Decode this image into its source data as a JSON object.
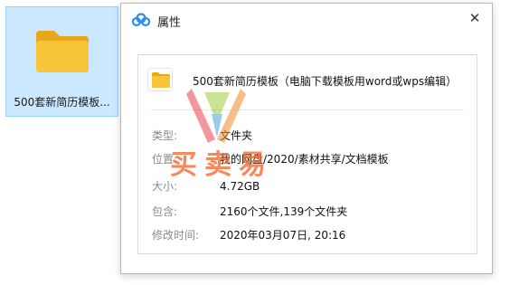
{
  "desktop": {
    "folder_name": "500套新简历模板...",
    "folder_icon": "folder-icon"
  },
  "dialog": {
    "title": "属性",
    "app_icon": "cloud-drive-icon",
    "close_glyph": "✕",
    "header_name": "500套新简历模板（电脑下载模板用word或wps编辑）",
    "fields": {
      "type_label": "类型:",
      "type_value": "文件夹",
      "location_label": "位置:",
      "location_value": "我的网盘/2020/素材共享/文档模板",
      "size_label": "大小:",
      "size_value": "4.72GB",
      "contains_label": "包含:",
      "contains_value": "2160个文件,139个文件夹",
      "modified_label": "修改时间:",
      "modified_value": "2020年03月07日, 20:16"
    }
  },
  "watermark": {
    "text": "买卖易",
    "colors": [
      "#e8434f",
      "#f28c28",
      "#9ccf3a",
      "#4aa3df"
    ]
  },
  "colors": {
    "selection_bg": "#cce8ff",
    "selection_border": "#99d1ff",
    "folder_yellow": "#f8c53a",
    "folder_tab": "#e6a817"
  }
}
